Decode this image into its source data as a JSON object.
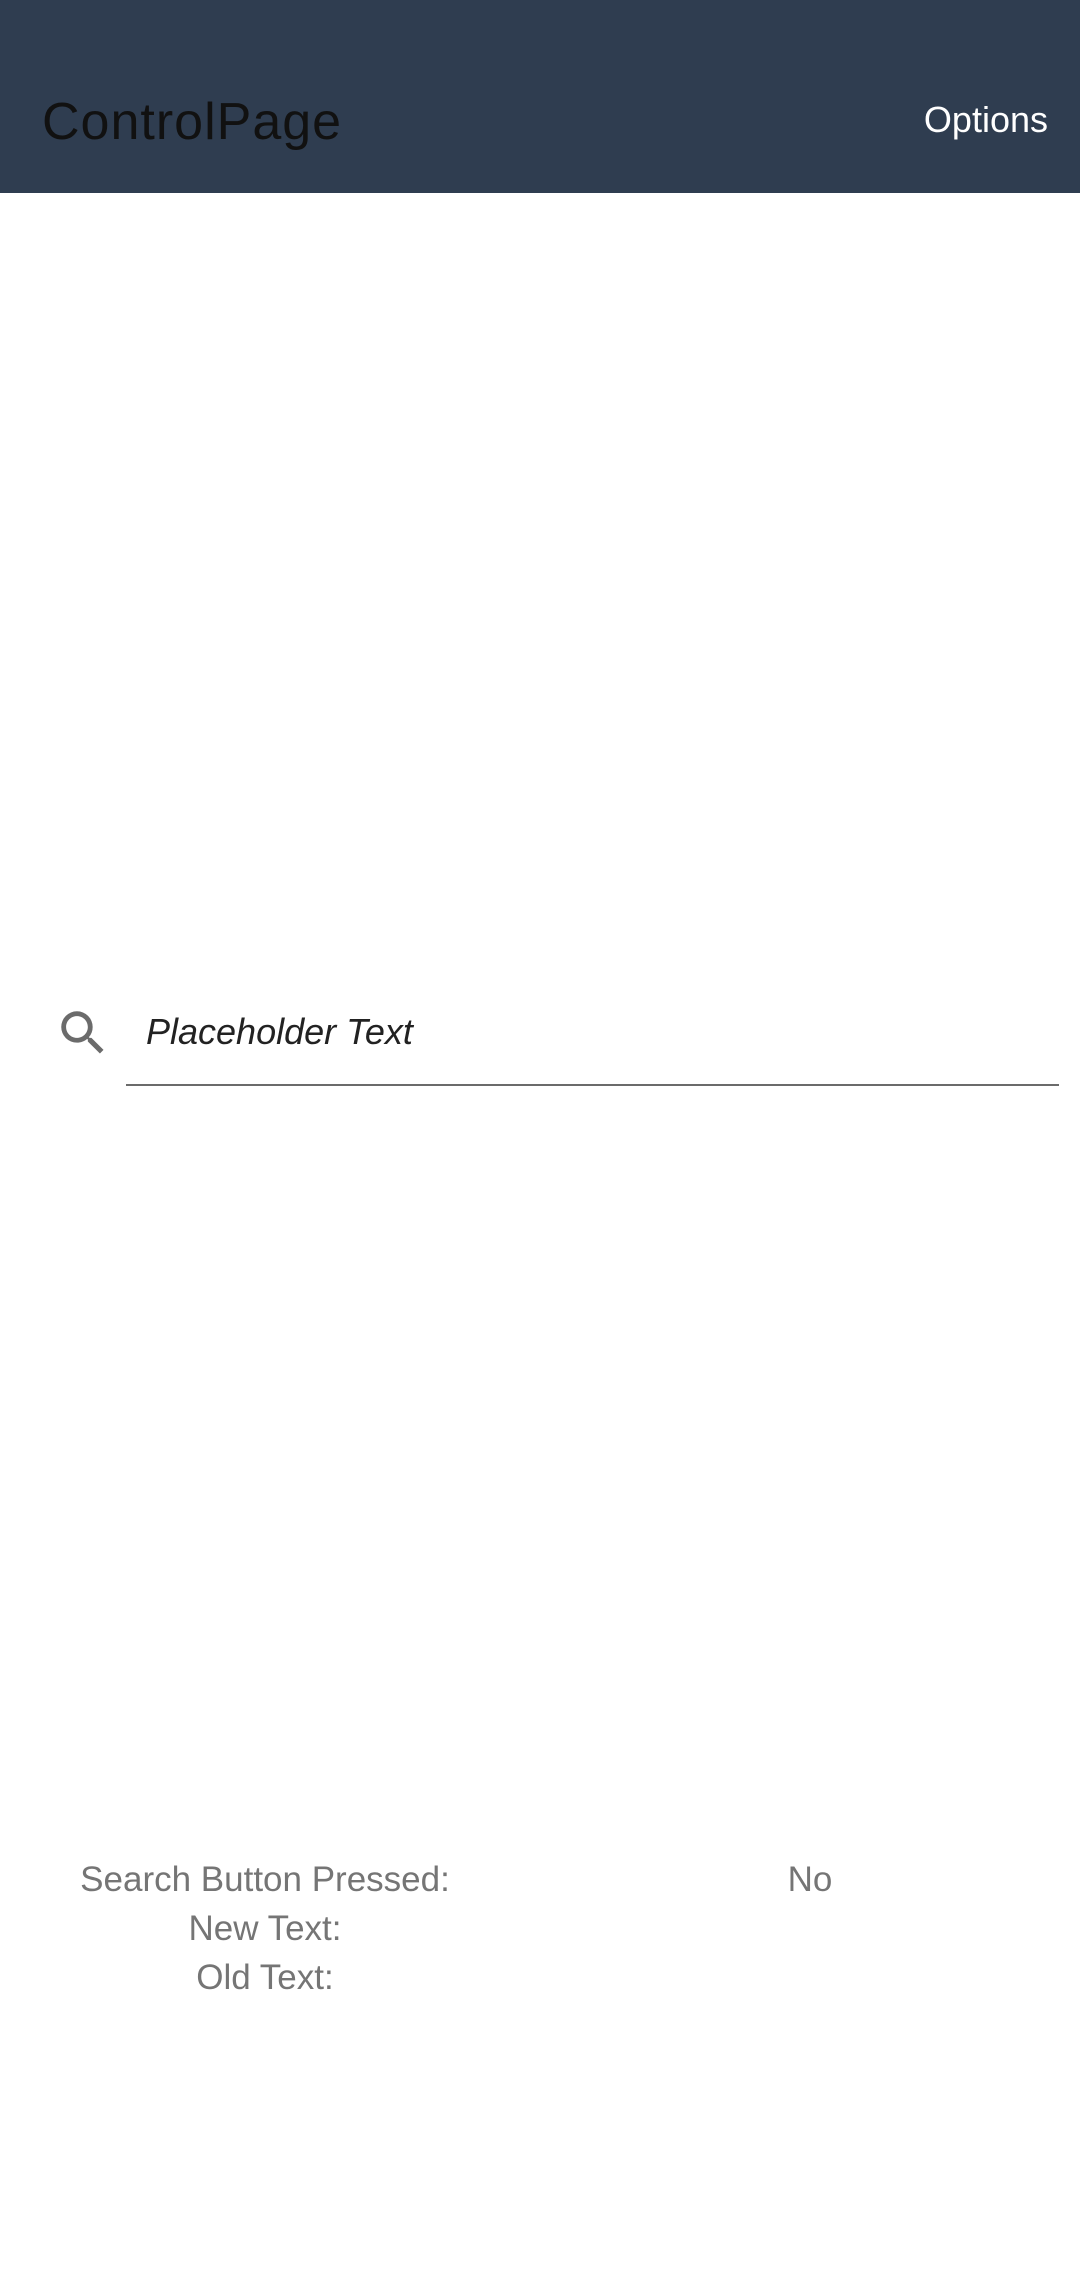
{
  "app_bar": {
    "title": "ControlPage",
    "options_label": "Options",
    "background_color": "#2f3d50"
  },
  "search": {
    "icon": "search-icon",
    "placeholder": "Placeholder Text",
    "value": ""
  },
  "status": {
    "search_button_pressed_label": "Search Button Pressed:",
    "search_button_pressed_value": "No",
    "new_text_label": "New Text:",
    "new_text_value": "",
    "old_text_label": "Old Text:",
    "old_text_value": ""
  }
}
